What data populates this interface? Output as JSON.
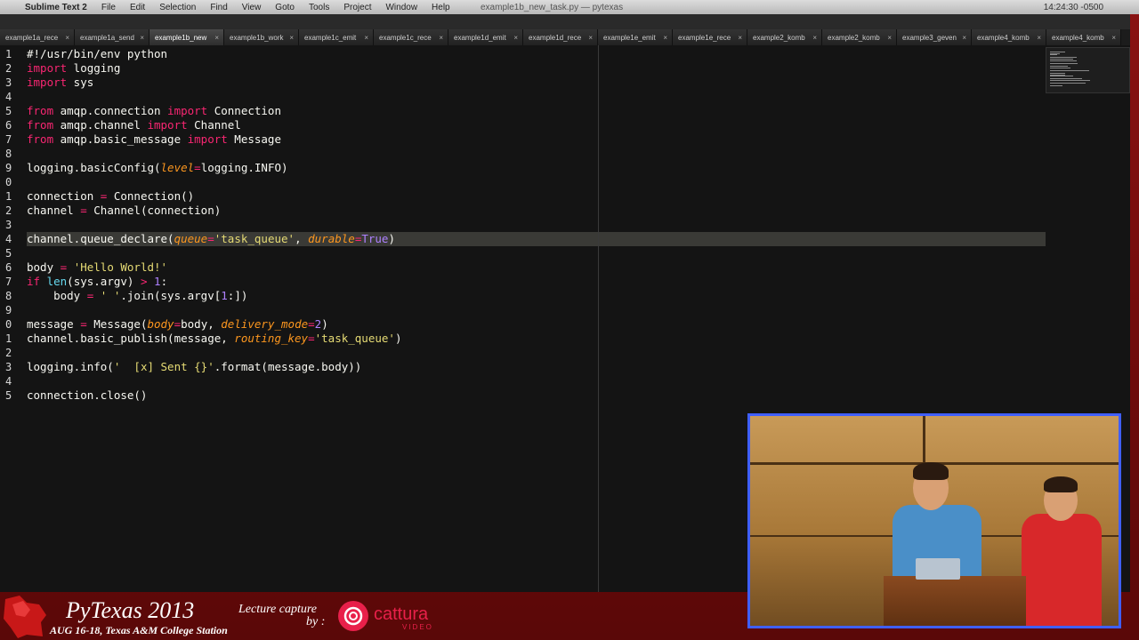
{
  "menubar": {
    "app": "Sublime Text 2",
    "items": [
      "File",
      "Edit",
      "Selection",
      "Find",
      "View",
      "Goto",
      "Tools",
      "Project",
      "Window",
      "Help"
    ],
    "window_title": "example1b_new_task.py — pytexas",
    "clock": "14:24:30 -0500"
  },
  "tabs": [
    {
      "label": "example1a_rece",
      "active": false
    },
    {
      "label": "example1a_send",
      "active": false
    },
    {
      "label": "example1b_new",
      "active": true
    },
    {
      "label": "example1b_work",
      "active": false
    },
    {
      "label": "example1c_emit",
      "active": false
    },
    {
      "label": "example1c_rece",
      "active": false
    },
    {
      "label": "example1d_emit",
      "active": false
    },
    {
      "label": "example1d_rece",
      "active": false
    },
    {
      "label": "example1e_emit",
      "active": false
    },
    {
      "label": "example1e_rece",
      "active": false
    },
    {
      "label": "example2_komb",
      "active": false
    },
    {
      "label": "example2_komb",
      "active": false
    },
    {
      "label": "example3_geven",
      "active": false
    },
    {
      "label": "example4_komb",
      "active": false
    },
    {
      "label": "example4_komb",
      "active": false
    }
  ],
  "tab_close_glyph": "×",
  "editor": {
    "line_numbers": [
      "1",
      "2",
      "3",
      "4",
      "5",
      "6",
      "7",
      "8",
      "9",
      "0",
      "1",
      "2",
      "3",
      "4",
      "5",
      "6",
      "7",
      "8",
      "9",
      "0",
      "1",
      "2",
      "3",
      "4",
      "5"
    ],
    "highlighted_line_index": 13,
    "lines": [
      [
        [
          "plain",
          "#!/usr/bin/env python"
        ]
      ],
      [
        [
          "kw",
          "import"
        ],
        [
          "plain",
          " logging"
        ]
      ],
      [
        [
          "kw",
          "import"
        ],
        [
          "plain",
          " sys"
        ]
      ],
      [
        [
          "plain",
          ""
        ]
      ],
      [
        [
          "kw",
          "from"
        ],
        [
          "plain",
          " amqp.connection "
        ],
        [
          "kw",
          "import"
        ],
        [
          "plain",
          " Connection"
        ]
      ],
      [
        [
          "kw",
          "from"
        ],
        [
          "plain",
          " amqp.channel "
        ],
        [
          "kw",
          "import"
        ],
        [
          "plain",
          " Channel"
        ]
      ],
      [
        [
          "kw",
          "from"
        ],
        [
          "plain",
          " amqp.basic_message "
        ],
        [
          "kw",
          "import"
        ],
        [
          "plain",
          " Message"
        ]
      ],
      [
        [
          "plain",
          ""
        ]
      ],
      [
        [
          "plain",
          "logging.basicConfig("
        ],
        [
          "arg",
          "level"
        ],
        [
          "op",
          "="
        ],
        [
          "plain",
          "logging.INFO)"
        ]
      ],
      [
        [
          "plain",
          ""
        ]
      ],
      [
        [
          "plain",
          "connection "
        ],
        [
          "op",
          "="
        ],
        [
          "plain",
          " Connection()"
        ]
      ],
      [
        [
          "plain",
          "channel "
        ],
        [
          "op",
          "="
        ],
        [
          "plain",
          " Channel(connection)"
        ]
      ],
      [
        [
          "plain",
          ""
        ]
      ],
      [
        [
          "plain",
          "channel.queue_declare("
        ],
        [
          "arg",
          "queue"
        ],
        [
          "op",
          "="
        ],
        [
          "str",
          "'task_queue'"
        ],
        [
          "plain",
          ", "
        ],
        [
          "arg",
          "durable"
        ],
        [
          "op",
          "="
        ],
        [
          "num",
          "True"
        ],
        [
          "plain",
          ")"
        ]
      ],
      [
        [
          "plain",
          ""
        ]
      ],
      [
        [
          "plain",
          "body "
        ],
        [
          "op",
          "="
        ],
        [
          "str",
          " 'Hello World!'"
        ]
      ],
      [
        [
          "kw",
          "if"
        ],
        [
          "plain",
          " "
        ],
        [
          "bi",
          "len"
        ],
        [
          "plain",
          "(sys.argv) "
        ],
        [
          "op",
          ">"
        ],
        [
          "plain",
          " "
        ],
        [
          "num",
          "1"
        ],
        [
          "plain",
          ":"
        ]
      ],
      [
        [
          "plain",
          "    body "
        ],
        [
          "op",
          "="
        ],
        [
          "str",
          " ' '"
        ],
        [
          "plain",
          ".join(sys.argv["
        ],
        [
          "num",
          "1"
        ],
        [
          "plain",
          ":])"
        ]
      ],
      [
        [
          "plain",
          ""
        ]
      ],
      [
        [
          "plain",
          "message "
        ],
        [
          "op",
          "="
        ],
        [
          "plain",
          " Message("
        ],
        [
          "arg",
          "body"
        ],
        [
          "op",
          "="
        ],
        [
          "plain",
          "body, "
        ],
        [
          "arg",
          "delivery_mode"
        ],
        [
          "op",
          "="
        ],
        [
          "num",
          "2"
        ],
        [
          "plain",
          ")"
        ]
      ],
      [
        [
          "plain",
          "channel.basic_publish(message, "
        ],
        [
          "arg",
          "routing_key"
        ],
        [
          "op",
          "="
        ],
        [
          "str",
          "'task_queue'"
        ],
        [
          "plain",
          ")"
        ]
      ],
      [
        [
          "plain",
          ""
        ]
      ],
      [
        [
          "plain",
          "logging.info("
        ],
        [
          "str",
          "'  [x] Sent {}'"
        ],
        [
          "plain",
          ".format(message.body))"
        ]
      ],
      [
        [
          "plain",
          ""
        ]
      ],
      [
        [
          "plain",
          "connection.close()"
        ]
      ]
    ]
  },
  "footer": {
    "event": "PyTexas 2013",
    "event_sub": "AUG 16-18, Texas A&M College Station",
    "capture_label": "Lecture capture",
    "capture_by": "by :",
    "vendor": "cattura",
    "vendor_sub": "VIDEO"
  },
  "colors": {
    "background": "#7a0e0e",
    "editor_bg": "#141414",
    "keyword": "#f92672",
    "string": "#e6db74",
    "number": "#ae81ff",
    "argument": "#fd971f",
    "builtin": "#66d9ef",
    "webcam_border": "#3f5fff",
    "vendor": "#e8204a"
  }
}
